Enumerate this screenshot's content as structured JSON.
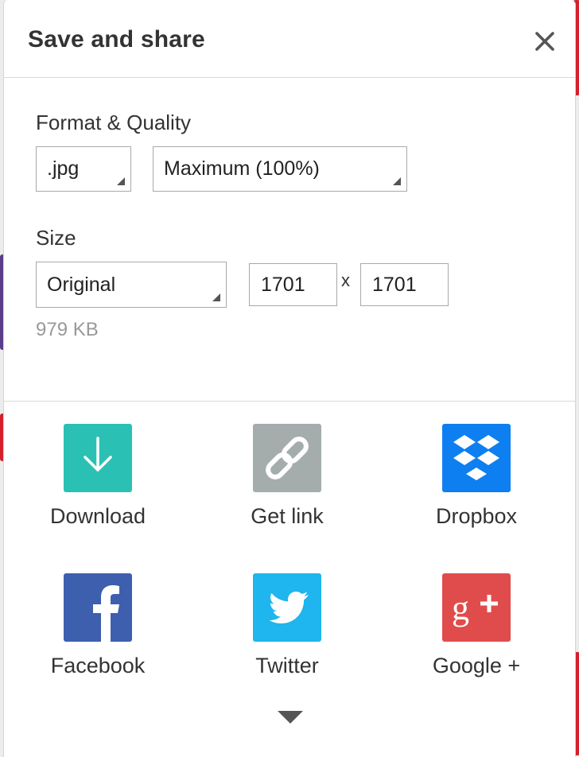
{
  "dialog": {
    "title": "Save and share",
    "close_icon": "close-icon"
  },
  "format": {
    "label": "Format & Quality",
    "type_value": ".jpg",
    "quality_value": "Maximum (100%)"
  },
  "size": {
    "label": "Size",
    "preset_value": "Original",
    "width": "1701",
    "times": "x",
    "height": "1701",
    "file_size": "979 KB"
  },
  "share": {
    "items": [
      {
        "label": "Download",
        "icon": "download-icon",
        "color": "#2bc0b4"
      },
      {
        "label": "Get link",
        "icon": "link-icon",
        "color": "#a4adac"
      },
      {
        "label": "Dropbox",
        "icon": "dropbox-icon",
        "color": "#0d7ff0"
      },
      {
        "label": "Facebook",
        "icon": "facebook-icon",
        "color": "#3d5fae"
      },
      {
        "label": "Twitter",
        "icon": "twitter-icon",
        "color": "#1fb5ee"
      },
      {
        "label": "Google +",
        "icon": "google-plus-icon",
        "color": "#e04c4b"
      }
    ],
    "more_icon": "chevron-down-icon"
  }
}
